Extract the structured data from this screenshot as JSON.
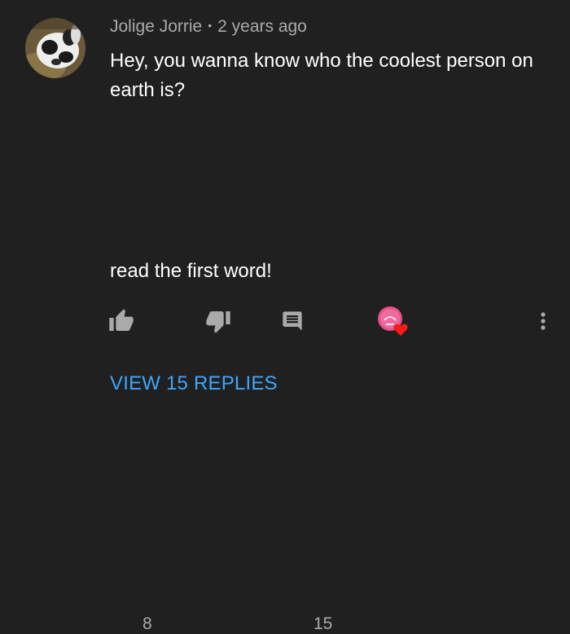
{
  "comment": {
    "author": "Jolige Jorrie",
    "separator": "•",
    "timestamp": "2 years ago",
    "text_line1": "Hey, you wanna know who the coolest person on earth is?",
    "text_line2": "read the first word!"
  },
  "actions": {
    "like_count": "8",
    "reply_count": "15",
    "like_icon": "thumbs-up-icon",
    "dislike_icon": "thumbs-down-icon",
    "reply_icon": "comment-icon",
    "heart_icon": "creator-heart-icon",
    "more_icon": "more-vert-icon"
  },
  "replies": {
    "view_label": "VIEW 15 REPLIES"
  },
  "colors": {
    "background": "#202020",
    "text": "#ffffff",
    "secondary_text": "#aaaaaa",
    "link": "#3ea6ff",
    "heart": "#ff0000"
  }
}
